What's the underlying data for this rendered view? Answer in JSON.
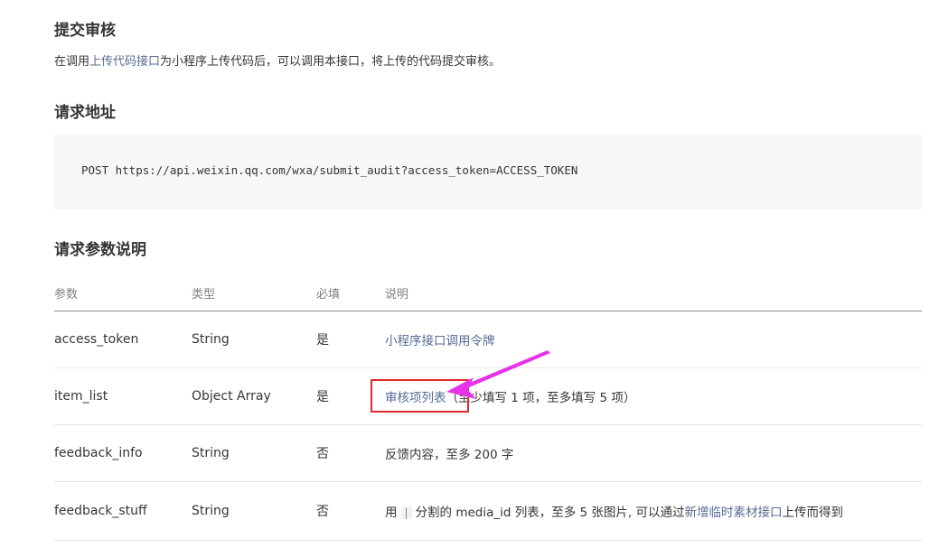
{
  "sections": {
    "title": "提交审核",
    "intro": {
      "prefix": "在调用",
      "link": "上传代码接口",
      "suffix": "为小程序上传代码后，可以调用本接口，将上传的代码提交审核。"
    },
    "request_url_title": "请求地址",
    "request_url": "POST https://api.weixin.qq.com/wxa/submit_audit?access_token=ACCESS_TOKEN",
    "params_title": "请求参数说明"
  },
  "table": {
    "headers": [
      "参数",
      "类型",
      "必填",
      "说明"
    ],
    "rows": [
      {
        "name": "access_token",
        "type": "String",
        "required": "是",
        "desc_link": "小程序接口调用令牌",
        "desc_text": ""
      },
      {
        "name": "item_list",
        "type": "Object Array",
        "required": "是",
        "desc_link": "审核项列表",
        "desc_text": "（至少填写 1 项，至多填写 5 项）"
      },
      {
        "name": "feedback_info",
        "type": "String",
        "required": "否",
        "desc_link": "",
        "desc_text": "反馈内容，至多 200 字"
      },
      {
        "name": "feedback_stuff",
        "type": "String",
        "required": "否",
        "desc_prefix": "用",
        "desc_pipe": "|",
        "desc_middle": "分割的 media_id 列表，至多 5 张图片, 可以通过",
        "desc_link": "新增临时素材接口",
        "desc_suffix": "上传而得到"
      }
    ]
  },
  "annotation": {
    "box_color": "#e0282e",
    "arrow_color": "#e832e8"
  }
}
